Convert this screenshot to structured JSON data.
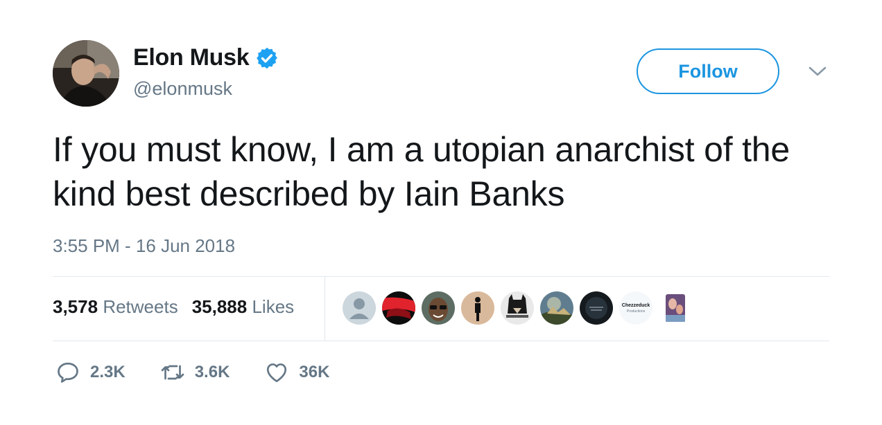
{
  "author": {
    "name": "Elon Musk",
    "handle": "@elonmusk",
    "verified": true
  },
  "follow_label": "Follow",
  "tweet": {
    "text": "If you must know, I am a utopian anarchist of the kind best described by Iain Banks",
    "timestamp": "3:55 PM - 16 Jun 2018"
  },
  "stats": {
    "retweets_count": "3,578",
    "retweets_label": "Retweets",
    "likes_count": "35,888",
    "likes_label": "Likes"
  },
  "liker_avatars": {
    "chezzeduck_title": "Chezzeduck",
    "chezzeduck_sub": "Productions"
  },
  "actions": {
    "replies": "2.3K",
    "retweets": "3.6K",
    "likes": "36K"
  },
  "colors": {
    "accent": "#1b95e0",
    "verified": "#1da1f2",
    "secondary_text": "#657786",
    "primary_text": "#14171a",
    "divider": "#e1e8ed"
  }
}
